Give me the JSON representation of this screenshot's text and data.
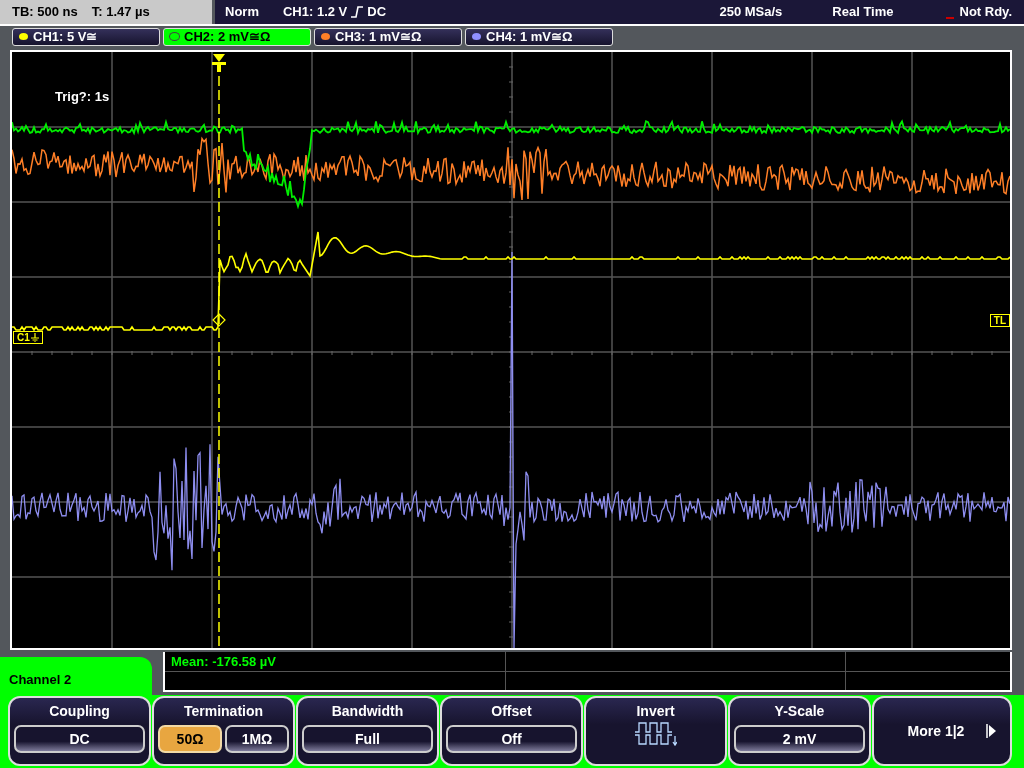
{
  "status_bar": {
    "timebase": "TB: 500 ns",
    "trigger_time": "T: 1.47 µs",
    "mode": "Norm",
    "trigger": "CH1: 1.2 V",
    "trigger_coupling": "DC",
    "sample_rate": "250 MSa/s",
    "acquisition": "Real Time",
    "state": "Not Rdy."
  },
  "channels": [
    {
      "label": "CH1: 5 V≅",
      "selected": false,
      "color": "#ffff00"
    },
    {
      "label": "CH2: 2 mV≅Ω",
      "selected": true,
      "color": "#00ff00"
    },
    {
      "label": "CH3: 1 mV≅Ω",
      "selected": false,
      "color": "#ff7f27"
    },
    {
      "label": "CH4: 1 mV≅Ω",
      "selected": false,
      "color": "#9090ff"
    }
  ],
  "plot": {
    "trigger_info": "Trig?: 1s",
    "markers": [
      {
        "kind": "ground",
        "label": "C1"
      },
      {
        "kind": "trigger_level",
        "label": "TL"
      }
    ]
  },
  "measurements": [
    "Mean: -176.58 µV"
  ],
  "menu": {
    "title": "Channel 2",
    "softkeys": [
      {
        "kind": "value",
        "label": "Coupling",
        "value": "DC"
      },
      {
        "kind": "choice",
        "label": "Termination",
        "options": [
          {
            "text": "50Ω",
            "selected": true
          },
          {
            "text": "1MΩ",
            "selected": false
          }
        ]
      },
      {
        "kind": "value",
        "label": "Bandwidth",
        "value": "Full"
      },
      {
        "kind": "value",
        "label": "Offset",
        "value": "Off"
      },
      {
        "kind": "icon",
        "label": "Invert"
      },
      {
        "kind": "value",
        "label": "Y-Scale",
        "value": "2 mV"
      },
      {
        "kind": "next",
        "label": "More 1|2"
      }
    ]
  }
}
